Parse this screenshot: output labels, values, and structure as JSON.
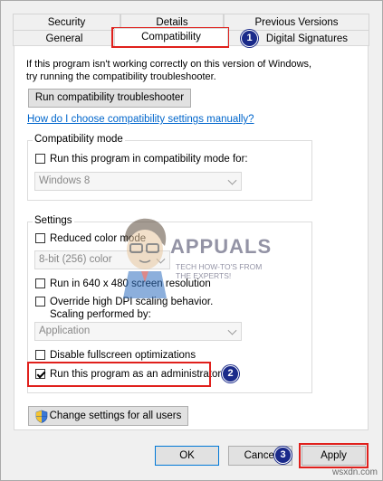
{
  "tabs": {
    "row1": [
      "Security",
      "Details",
      "Previous Versions"
    ],
    "row2": [
      "General",
      "Compatibility",
      "Digital Signatures"
    ]
  },
  "intro": {
    "line1": "If this program isn't working correctly on this version of Windows,",
    "line2": "try running the compatibility troubleshooter."
  },
  "troubleshooter_button": "Run compatibility troubleshooter",
  "help_link": "How do I choose compatibility settings manually?",
  "compat_mode": {
    "legend": "Compatibility mode",
    "checkbox_label": "Run this program in compatibility mode for:",
    "checked": false,
    "os_value": "Windows 8"
  },
  "settings": {
    "legend": "Settings",
    "reduced_color": {
      "label": "Reduced color mode",
      "checked": false
    },
    "color_value": "8-bit (256) color",
    "res_640": {
      "label": "Run in 640 x 480 screen resolution",
      "checked": false
    },
    "dpi_override": {
      "label_line1": "Override high DPI scaling behavior.",
      "label_line2": "Scaling performed by:",
      "checked": false
    },
    "dpi_value": "Application",
    "disable_fullscreen": {
      "label": "Disable fullscreen optimizations",
      "checked": false
    },
    "run_as_admin": {
      "label": "Run this program as an administrator",
      "checked": true
    }
  },
  "change_all_users_button": "Change settings for all users",
  "footer": {
    "ok": "OK",
    "cancel": "Cancel",
    "apply": "Apply"
  },
  "badges": [
    "1",
    "2",
    "3"
  ],
  "watermark": {
    "brand": "APPUALS",
    "tag_line1": "TECH HOW-TO'S FROM",
    "tag_line2": "THE EXPERTS!"
  },
  "site": "wsxdn.com",
  "colors": {
    "highlight": "#e0201c",
    "badge": "#1a2a8a",
    "link": "#0066cc",
    "accent_border": "#0078d7"
  },
  "icons": [
    "checkbox",
    "shield-icon",
    "dropdown-arrow-icon",
    "appuals-mascot-icon"
  ]
}
